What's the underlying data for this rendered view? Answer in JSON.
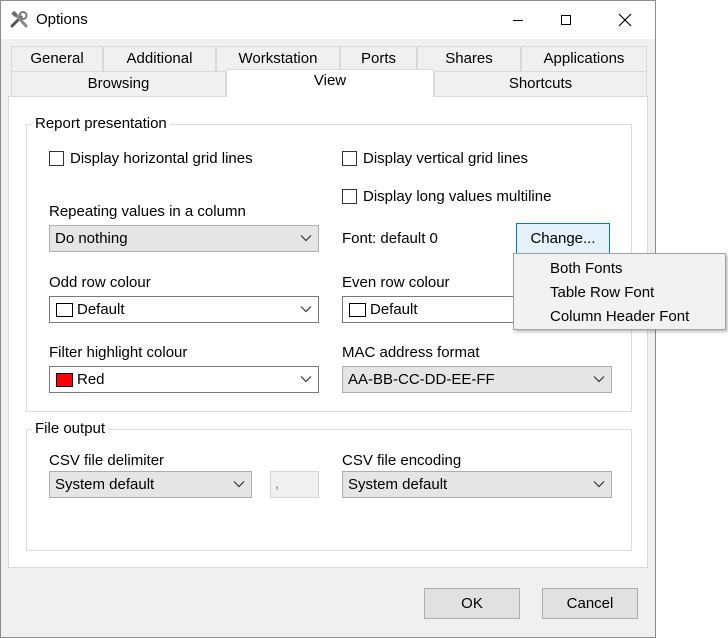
{
  "window": {
    "title": "Options"
  },
  "tabs": {
    "row1": [
      "General",
      "Additional",
      "Workstation",
      "Ports",
      "Shares",
      "Applications"
    ],
    "row2": [
      "Browsing",
      "View",
      "Shortcuts"
    ],
    "active": "View"
  },
  "report": {
    "group_label": "Report presentation",
    "horizontal_grid": {
      "label": "Display horizontal grid lines",
      "checked": false
    },
    "vertical_grid": {
      "label": "Display vertical grid lines",
      "checked": false
    },
    "long_values": {
      "label": "Display long values multiline",
      "checked": false
    },
    "repeating": {
      "label": "Repeating values in a column",
      "value": "Do nothing"
    },
    "font": {
      "label": "Font: default 0",
      "change_button": "Change..."
    },
    "odd_row": {
      "label": "Odd row colour",
      "value": "Default",
      "swatch": "#ffffff"
    },
    "even_row": {
      "label": "Even row colour",
      "value": "Default",
      "swatch": "#ffffff"
    },
    "filter_highlight": {
      "label": "Filter highlight colour",
      "value": "Red",
      "swatch": "#ff0000"
    },
    "mac_format": {
      "label": "MAC address format",
      "value": "AA-BB-CC-DD-EE-FF"
    }
  },
  "file_output": {
    "group_label": "File output",
    "delimiter": {
      "label": "CSV file delimiter",
      "value": "System default",
      "char": ","
    },
    "encoding": {
      "label": "CSV file encoding",
      "value": "System default"
    }
  },
  "font_menu": {
    "items": [
      "Both Fonts",
      "Table Row Font",
      "Column Header Font"
    ]
  },
  "buttons": {
    "ok": "OK",
    "cancel": "Cancel"
  },
  "colors": {
    "focus_border": "#0078d7",
    "tab_border": "#d9d9d9",
    "dialog_bg": "#f0f0f0"
  }
}
